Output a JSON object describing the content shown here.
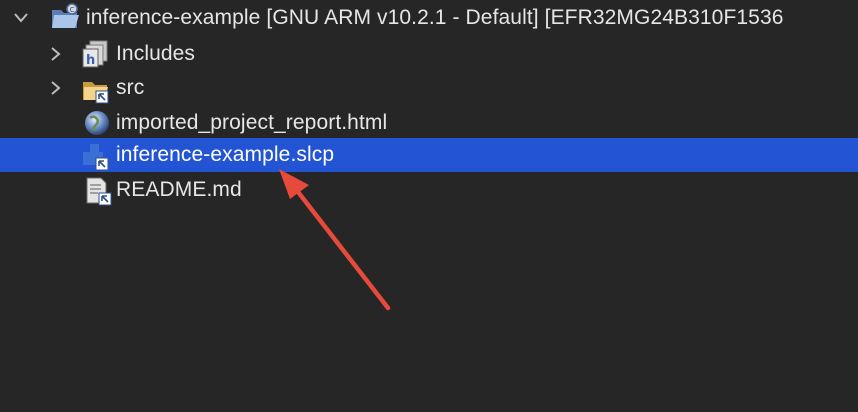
{
  "project": {
    "name": "inference-example",
    "toolchain": "[GNU ARM v10.2.1 - Default]",
    "device": "[EFR32MG24B310F1536"
  },
  "tree": [
    {
      "label": "Includes",
      "icon": "includes-icon",
      "expandable": true
    },
    {
      "label": "src",
      "icon": "folder-link-icon",
      "expandable": true
    },
    {
      "label": "imported_project_report.html",
      "icon": "globe-icon",
      "expandable": false
    },
    {
      "label": "inference-example.slcp",
      "icon": "slcp-component-icon",
      "expandable": false,
      "selected": true
    },
    {
      "label": "README.md",
      "icon": "text-file-link-icon",
      "expandable": false
    }
  ],
  "colors": {
    "background": "#262626",
    "selection": "#2354d3",
    "annotation_arrow": "#e64a3a"
  }
}
